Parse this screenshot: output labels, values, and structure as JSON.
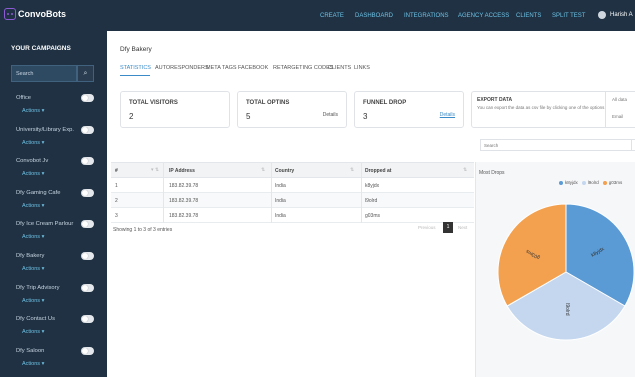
{
  "app": {
    "name": "ConvoBots"
  },
  "nav": [
    "CREATE",
    "DASHBOARD",
    "INTEGRATIONS",
    "AGENCY ACCESS",
    "CLIENTS",
    "SPLIT TEST"
  ],
  "user": {
    "name": "Harish A"
  },
  "sidebar": {
    "title": "YOUR CAMPAIGNS",
    "search_placeholder": "Search",
    "actions_label": "Actions ▾",
    "campaigns": [
      {
        "name": "Office",
        "enabled": false
      },
      {
        "name": "University/Library Exp...",
        "enabled": false
      },
      {
        "name": "Convobot Jv",
        "enabled": false
      },
      {
        "name": "Dfy Gaming Cafe",
        "enabled": false
      },
      {
        "name": "Dfy Ice Cream Parlour",
        "enabled": false
      },
      {
        "name": "Dfy Bakery",
        "enabled": false
      },
      {
        "name": "Dfy Trip Advisory",
        "enabled": false
      },
      {
        "name": "Dfy Contact Us",
        "enabled": false
      },
      {
        "name": "Dfy Saloon",
        "enabled": false
      }
    ]
  },
  "main": {
    "title": "Dfy Bakery",
    "tabs": [
      "STATISTICS",
      "AUTORESPONDERS",
      "META TAGS",
      "FACEBOOK",
      "RETARGETING CODES",
      "CLIENTS",
      "LINKS"
    ],
    "active_tab": "STATISTICS",
    "cards": [
      {
        "title": "TOTAL VISITORS",
        "value": "2",
        "link": ""
      },
      {
        "title": "TOTAL OPTINS",
        "value": "5",
        "link": "Details"
      },
      {
        "title": "FUNNEL DROP",
        "value": "3",
        "link": "Details"
      }
    ],
    "export": {
      "title": "EXPORT DATA",
      "text": "You can export the data as csv file by clicking one of the options",
      "option1": "All data",
      "option2": "Email"
    },
    "table_search_placeholder": "Search",
    "table": {
      "headers": [
        "#",
        "IP Address",
        "Country",
        "Dropped at"
      ],
      "rows": [
        [
          "1",
          "183.82.39.78",
          "India",
          "k8yjdx"
        ],
        [
          "2",
          "183.82.39.78",
          "India",
          "l9olrd"
        ],
        [
          "3",
          "183.82.39.78",
          "India",
          "g03ms"
        ]
      ],
      "info": "Showing 1 to 3 of 3 entries",
      "pagination": {
        "previous": "Previous",
        "current": "1",
        "next": "Next"
      }
    },
    "chart_title": "Most Drops"
  },
  "chart_data": {
    "type": "pie",
    "title": "Most Drops",
    "legend_position": "top-right",
    "slices": [
      {
        "label": "k8yjdx",
        "value": 1,
        "color": "#5b9bd5"
      },
      {
        "label": "l9olrd",
        "value": 1,
        "color": "#c4d7ef"
      },
      {
        "label": "g03ms",
        "value": 1,
        "color": "#f4a14f"
      }
    ]
  }
}
